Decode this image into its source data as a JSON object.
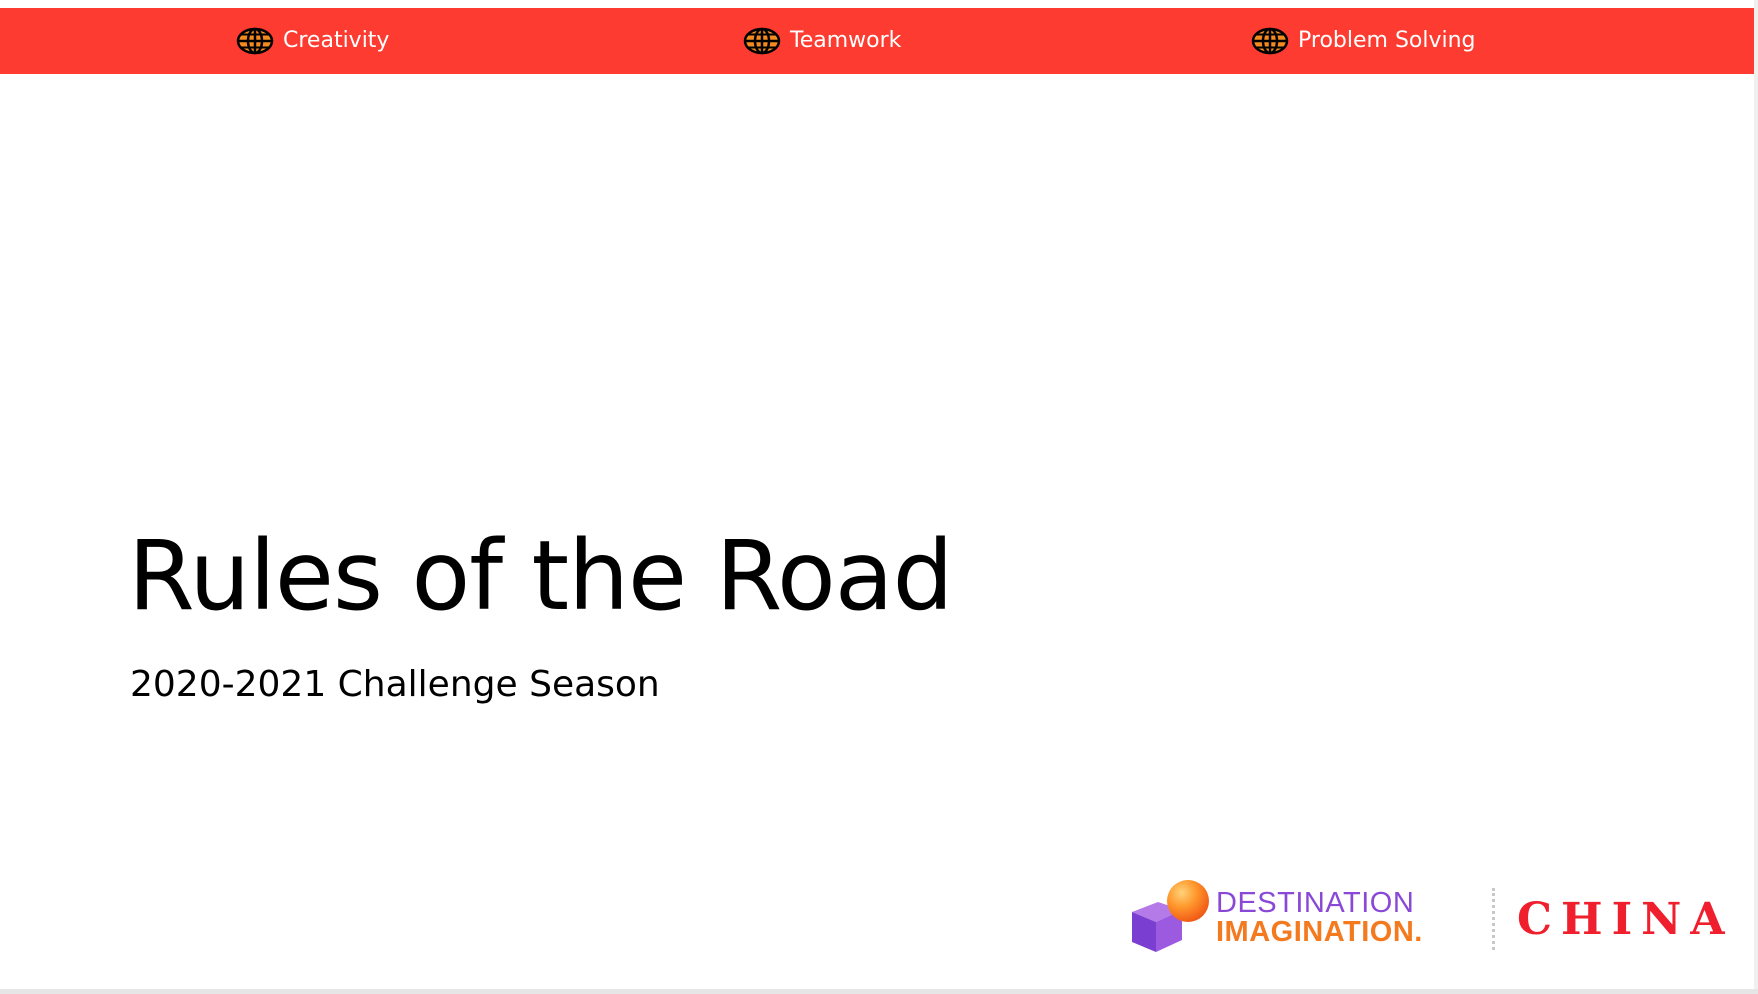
{
  "banner": {
    "items": [
      {
        "label": "Creativity",
        "icon": "globe-icon"
      },
      {
        "label": "Teamwork",
        "icon": "globe-icon"
      },
      {
        "label": "Problem Solving",
        "icon": "globe-icon"
      }
    ]
  },
  "slide": {
    "title": "Rules of the Road",
    "subtitle": "2020-2021 Challenge Season"
  },
  "logo": {
    "line1": "DESTINATION",
    "line2": "IMAGINATION.",
    "region": "CHINA"
  },
  "colors": {
    "banner": "#fd3b30",
    "globe": "#f58a1f",
    "destination": "#8a48d6",
    "imagination": "#f47a1f",
    "china": "#ef1f2d",
    "text": "#000000"
  }
}
